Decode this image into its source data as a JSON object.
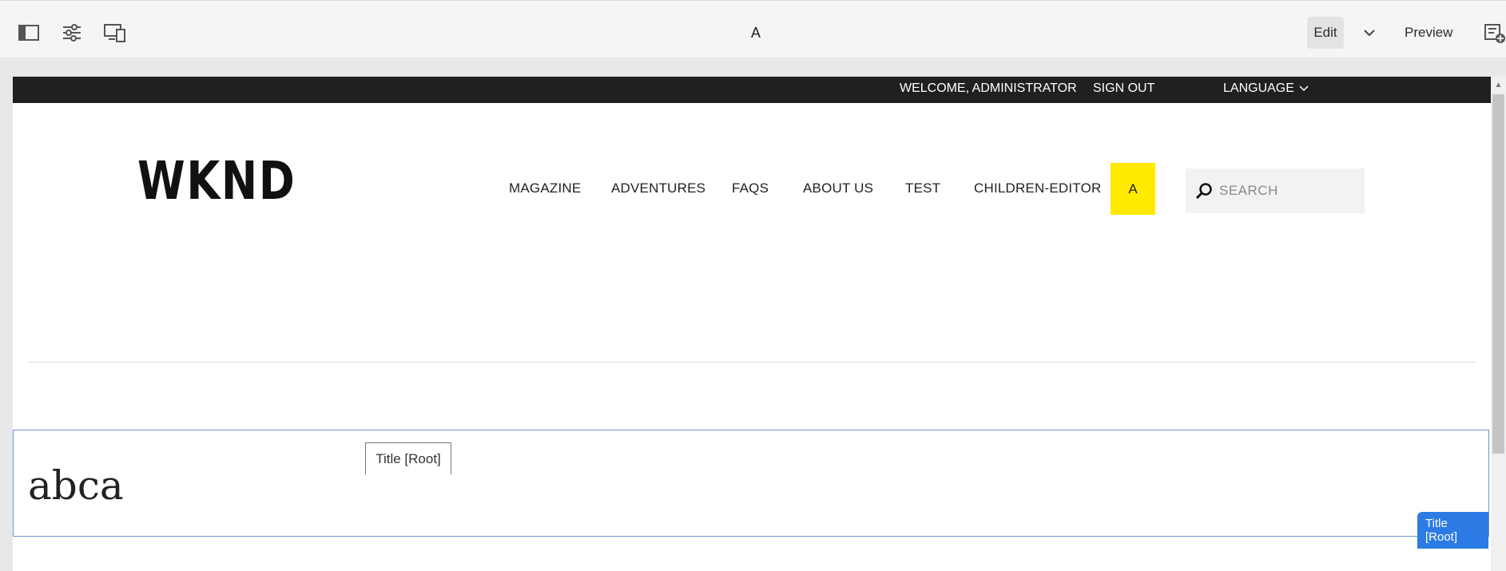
{
  "toolbar": {
    "page_name": "A",
    "edit_label": "Edit",
    "preview_label": "Preview",
    "icons": [
      "side-panel-icon",
      "page-properties-icon",
      "emulator-icon",
      "annotations-icon"
    ]
  },
  "site": {
    "topbar": {
      "welcome": "WELCOME, ADMINISTRATOR",
      "sign_out": "SIGN OUT",
      "language": "LANGUAGE"
    },
    "logo": "WKND",
    "nav": [
      {
        "label": "MAGAZINE"
      },
      {
        "label": "ADVENTURES"
      },
      {
        "label": "FAQS"
      },
      {
        "label": "ABOUT US"
      },
      {
        "label": "TEST"
      },
      {
        "label": "CHILDREN-EDITOR"
      }
    ],
    "nav_active": "A",
    "search_placeholder": "SEARCH"
  },
  "content": {
    "title": "abca",
    "component_tag": "Title [Root]",
    "hover_label": "Title [Root]"
  },
  "colors": {
    "accent_yellow": "#ffea00",
    "selection_blue": "#2c7be5",
    "topbar": "#202020"
  }
}
